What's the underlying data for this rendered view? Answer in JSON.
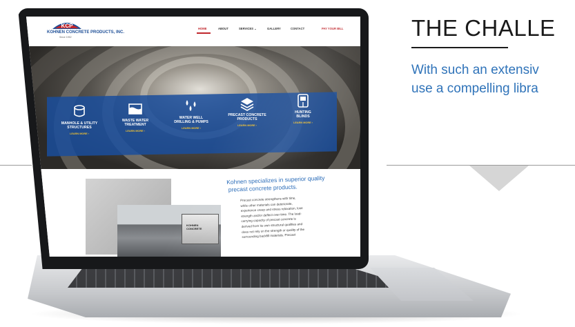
{
  "challenge": {
    "title": "THE CHALLE",
    "body_line1": "With such an extensiv",
    "body_line2": "use a compelling libra"
  },
  "site": {
    "logo_mark": "KCP",
    "logo_name": "KOHNEN CONCRETE PRODUCTS, INC.",
    "since": "Since 1952",
    "nav": [
      {
        "label": "HOME"
      },
      {
        "label": "ABOUT"
      },
      {
        "label": "SERVICES ⌄"
      },
      {
        "label": "GALLERY"
      },
      {
        "label": "CONTACT"
      },
      {
        "label": "PAY YOUR BILL"
      }
    ],
    "services": [
      {
        "title1": "MANHOLE & UTILITY",
        "title2": "STRUCTURES",
        "link": "LEARN MORE ›",
        "icon": "manhole-icon"
      },
      {
        "title1": "WASTE WATER",
        "title2": "TREATMENT",
        "link": "LEARN MORE ›",
        "icon": "water-tank-icon"
      },
      {
        "title1": "WATER WELL",
        "title2": "DRILLING & PUMPS",
        "link": "LEARN MORE ›",
        "icon": "water-drops-icon"
      },
      {
        "title1": "PRECAST CONCRETE",
        "title2": "PRODUCTS",
        "link": "LEARN MORE ›",
        "icon": "concrete-layers-icon"
      },
      {
        "title1": "HUNTING",
        "title2": "BLINDS",
        "link": "LEARN MORE ›",
        "icon": "hunting-blind-icon"
      }
    ],
    "headline1": "Kohnen specializes in superior quality",
    "headline2": "precast concrete products.",
    "paragraph": [
      "Precast concrete strengthens with time,",
      "while other materials can deteriorate,",
      "experience creep and stress relaxation, lose",
      "strength and/or deflect over time. The load-",
      "carrying capacity of precast concrete is",
      "derived from its own structural qualities and",
      "does not rely on the strength or quality of the",
      "surrounding backfill materials. Precast"
    ],
    "truck_label1": "KOHNEN",
    "truck_label2": "CONCRETE"
  },
  "colors": {
    "brand_blue": "#1e4f97",
    "accent_red": "#c0262c",
    "link_yellow": "#f2c230",
    "body_blue": "#2f73b9"
  }
}
